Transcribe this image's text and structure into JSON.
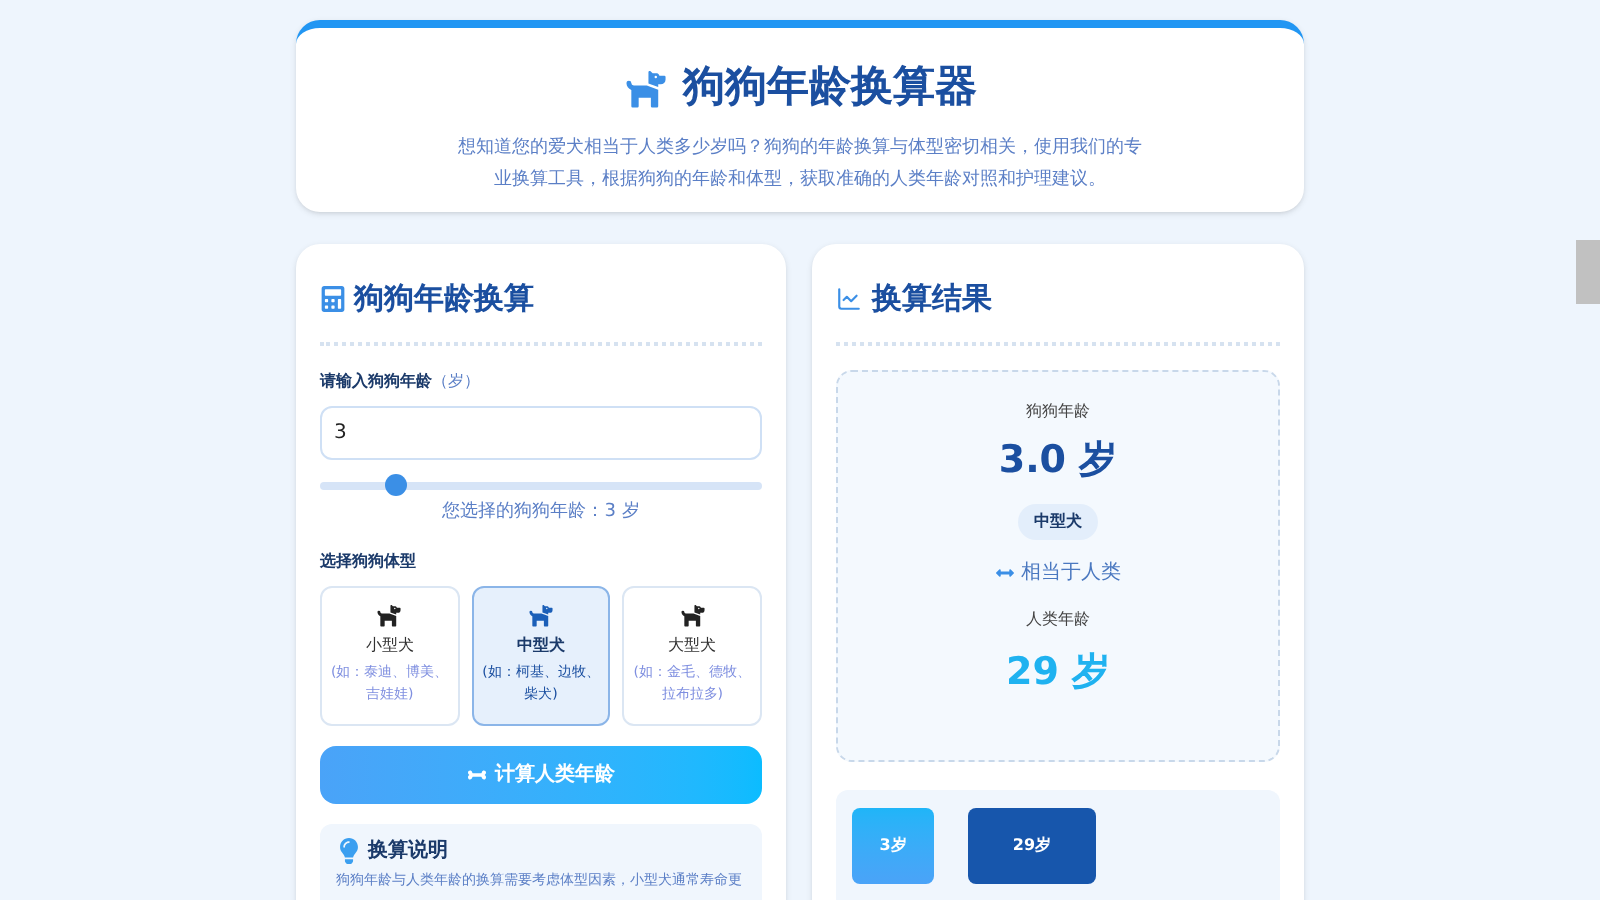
{
  "header": {
    "title": "狗狗年龄换算器",
    "description": "想知道您的爱犬相当于人类多少岁吗？狗狗的年龄换算与体型密切相关，使用我们的专业换算工具，根据狗狗的年龄和体型，获取准确的人类年龄对照和护理建议。"
  },
  "converter": {
    "title": "狗狗年龄换算",
    "age_label": "请输入狗狗年龄",
    "age_unit": "（岁）",
    "age_value": "3",
    "slider": {
      "level": 0.17
    },
    "selected_text": "您选择的狗狗年龄：3 岁",
    "size_label": "选择狗狗体型",
    "sizes": [
      {
        "name": "小型犬",
        "examples": "(如：泰迪、博美、吉娃娃)",
        "selected": false
      },
      {
        "name": "中型犬",
        "examples": "(如：柯基、边牧、柴犬)",
        "selected": true
      },
      {
        "name": "大型犬",
        "examples": "(如：金毛、德牧、拉布拉多)",
        "selected": false
      }
    ],
    "button": "计算人类年龄",
    "info_title": "换算说明",
    "info_text": "狗狗年龄与人类年龄的换算需要考虑体型因素，小型犬通常寿命更"
  },
  "result": {
    "title": "换算结果",
    "dog_age_label": "狗狗年龄",
    "dog_age": "3.0 岁",
    "size_badge": "中型犬",
    "equals": "相当于人类",
    "human_age_label": "人类年龄",
    "human_age": "29 岁",
    "bars": [
      {
        "label": "3岁",
        "kind": "dog"
      },
      {
        "label": "29岁",
        "kind": "human"
      }
    ]
  }
}
